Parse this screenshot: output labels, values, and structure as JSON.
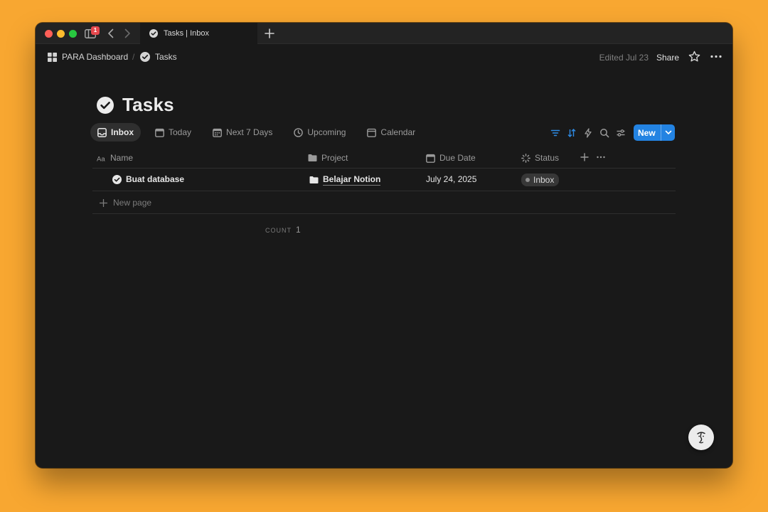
{
  "browser": {
    "tab_title": "Tasks | Inbox",
    "tab_badge": "1"
  },
  "topbar": {
    "breadcrumb": [
      {
        "label": "PARA Dashboard",
        "icon": "grid-icon"
      },
      {
        "label": "Tasks",
        "icon": "check-circle-icon"
      }
    ],
    "separator": "/",
    "edited": "Edited Jul 23",
    "share_label": "Share"
  },
  "page": {
    "title": "Tasks",
    "icon": "check-circle-icon"
  },
  "views": [
    {
      "label": "Inbox",
      "icon": "inbox-icon",
      "active": true
    },
    {
      "label": "Today",
      "icon": "calendar-icon"
    },
    {
      "label": "Next 7 Days",
      "icon": "calendar-grid-icon"
    },
    {
      "label": "Upcoming",
      "icon": "clock-icon"
    },
    {
      "label": "Calendar",
      "icon": "calendar-icon"
    }
  ],
  "toolbar": {
    "new_label": "New",
    "accent_color": "#2383E2"
  },
  "table": {
    "columns": [
      {
        "label": "Name",
        "icon": "text-aa-icon"
      },
      {
        "label": "Project",
        "icon": "folder-icon"
      },
      {
        "label": "Due Date",
        "icon": "calendar-icon"
      },
      {
        "label": "Status",
        "icon": "status-spinner-icon"
      }
    ],
    "rows": [
      {
        "name": "Buat database",
        "project": "Belajar Notion",
        "due_date": "July 24, 2025",
        "status": "Inbox"
      }
    ],
    "new_page_label": "New page",
    "count_label": "COUNT",
    "count_value": "1"
  },
  "colors": {
    "background": "#F8A731",
    "window": "#191919"
  }
}
